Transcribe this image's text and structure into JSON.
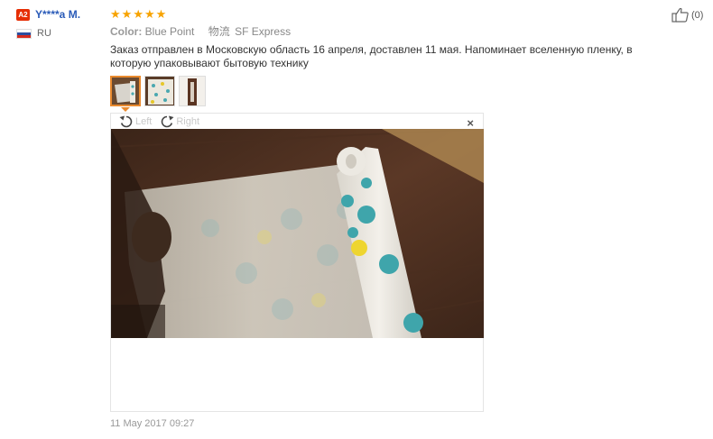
{
  "user": {
    "level_badge": "A2",
    "name": "Y****a M.",
    "country": "RU"
  },
  "review": {
    "rating": 5,
    "color_label": "Color:",
    "color_value": "Blue Point",
    "shipping_label": "物流",
    "shipping_value": "SF Express",
    "text": "Заказ отправлен в Московскую область 16 апреля, доставлен 11 мая. Напоминает вселенную пленку, в которую упаковывают бытовую технику",
    "date": "11 May 2017 09:27"
  },
  "helpful": {
    "count": "(0)"
  },
  "viewer": {
    "rotate_left": "Left",
    "rotate_right": "Right",
    "close": "×"
  },
  "icons": [
    "thumbs-up-icon",
    "rotate-left-icon",
    "rotate-right-icon",
    "close-icon",
    "star-icon",
    "flag-icon"
  ],
  "colors": {
    "star": "#f7a300",
    "user_name": "#2a5bb8",
    "badge": "#e62e04",
    "active_thumb": "#e98a2e"
  }
}
